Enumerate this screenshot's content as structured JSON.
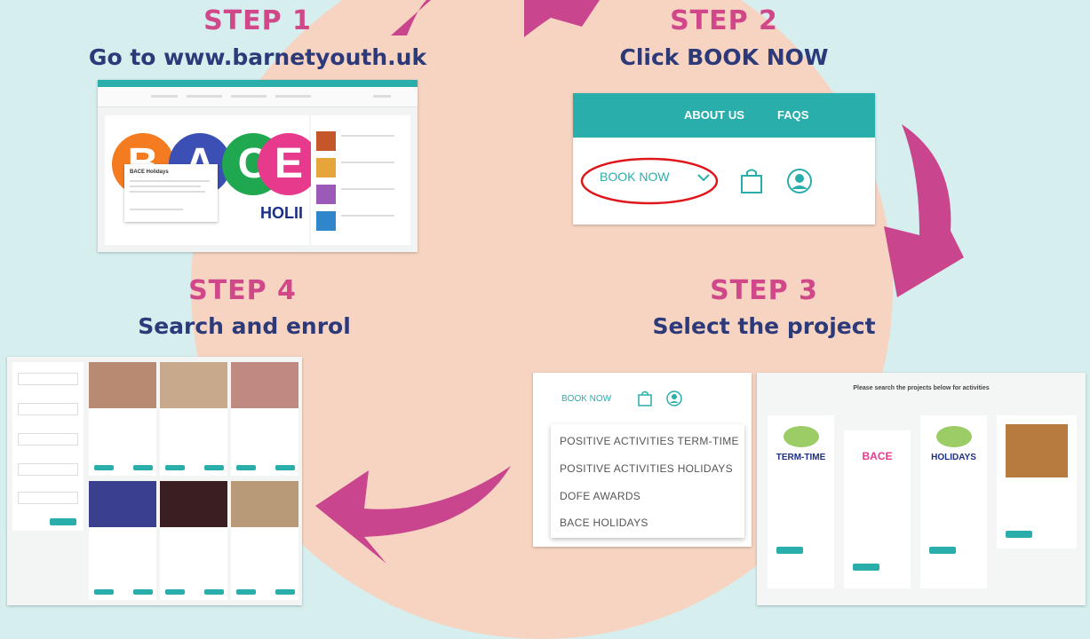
{
  "steps": [
    {
      "title": "STEP 1",
      "subtitle": "Go to www.barnetyouth.uk"
    },
    {
      "title": "STEP 2",
      "subtitle": "Click BOOK NOW"
    },
    {
      "title": "STEP 3",
      "subtitle": "Select the project"
    },
    {
      "title": "STEP 4",
      "subtitle": "Search and enrol"
    }
  ],
  "step1_shot": {
    "logo_letters": [
      "B",
      "A",
      "C",
      "E"
    ],
    "holiday_text": "HOLII",
    "card_title": "BACE Holidays"
  },
  "step2_shot": {
    "nav": [
      "ABOUT US",
      "FAQS"
    ],
    "book_now": "BOOK NOW",
    "highlight_color": "#e0161d"
  },
  "step3_menu": {
    "book_now": "BOOK NOW",
    "items": [
      "POSITIVE ACTIVITIES TERM-TIME",
      "POSITIVE ACTIVITIES HOLIDAYS",
      "DOFE AWARDS",
      "BACE HOLIDAYS"
    ]
  },
  "step3_projects": {
    "header": "Please search the projects below for activities",
    "cards": [
      {
        "logo": "TERM-TIME"
      },
      {
        "logo": "BACE"
      },
      {
        "logo": "HOLIDAYS"
      },
      {
        "logo": ""
      }
    ]
  },
  "colors": {
    "background": "#d6eeee",
    "circle": "#f7d4c2",
    "step_title": "#d0478a",
    "step_subtitle": "#2c3a7a",
    "arrow": "#c9458d",
    "teal": "#2aaeab"
  },
  "icons": [
    "curved-arrow-icon",
    "shopping-bag-icon",
    "user-account-icon",
    "chevron-down-icon"
  ]
}
